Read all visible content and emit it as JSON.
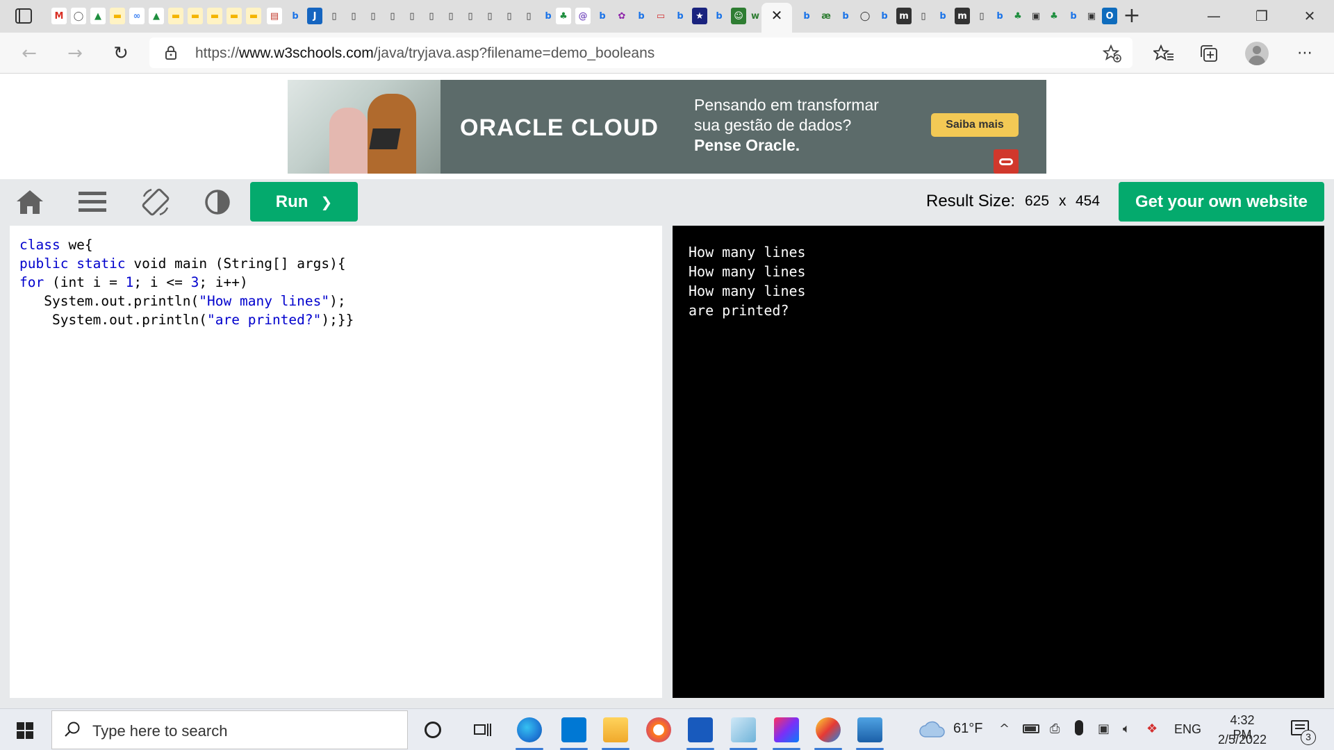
{
  "browser": {
    "tab_close_glyph": "✕",
    "new_tab_glyph": "+",
    "window_controls": {
      "minimize": "—",
      "maximize": "❐",
      "close": "✕"
    },
    "address": {
      "protocol": "https://",
      "domain": "www.w3schools.com",
      "path": "/java/tryjava.asp?filename=demo_booleans"
    }
  },
  "ad": {
    "logo": "ORACLE CLOUD",
    "line1": "Pensando em transformar",
    "line2": "sua gestão de dados?",
    "line3": "Pense Oracle.",
    "cta": "Saiba mais"
  },
  "toolbar": {
    "run_label": "Run",
    "run_chevron": "❯",
    "result_size_label": "Result Size:",
    "result_width": "625",
    "result_x": "x",
    "result_height": "454",
    "get_website_label": "Get your own website"
  },
  "code": {
    "lines": [
      [
        {
          "t": "class",
          "c": "kw"
        },
        {
          "t": " we{",
          "c": ""
        }
      ],
      [
        {
          "t": "public",
          "c": "kw"
        },
        {
          "t": " ",
          "c": ""
        },
        {
          "t": "static",
          "c": "kw"
        },
        {
          "t": " void main (String[] args){",
          "c": ""
        }
      ],
      [
        {
          "t": "for",
          "c": "kw"
        },
        {
          "t": " (int i = ",
          "c": ""
        },
        {
          "t": "1",
          "c": "kw"
        },
        {
          "t": "; i <= ",
          "c": ""
        },
        {
          "t": "3",
          "c": "kw"
        },
        {
          "t": "; i++)",
          "c": ""
        }
      ],
      [
        {
          "t": "   System.out.println(",
          "c": ""
        },
        {
          "t": "\"How many lines\"",
          "c": "str2"
        },
        {
          "t": ");",
          "c": ""
        }
      ],
      [
        {
          "t": "    System.out.println(",
          "c": ""
        },
        {
          "t": "\"are printed?\"",
          "c": "str2"
        },
        {
          "t": ");}}",
          "c": ""
        }
      ]
    ]
  },
  "output": {
    "lines": [
      "How many lines",
      "How many lines",
      "How many lines",
      "are printed?"
    ]
  },
  "taskbar": {
    "search_placeholder": "Type here to search",
    "weather": "61°F",
    "language": "ENG",
    "time": "4:32 PM",
    "date": "2/5/2022",
    "notification_count": "3"
  }
}
